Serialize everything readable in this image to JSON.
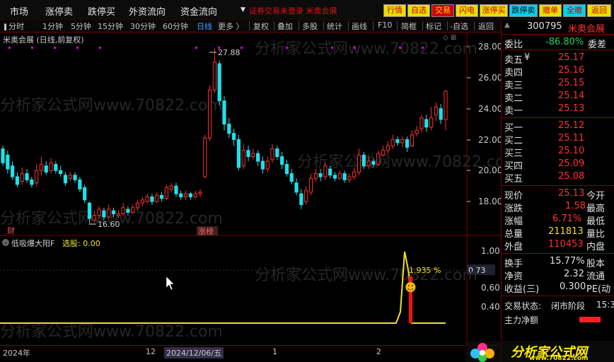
{
  "topbar": {
    "menus": [
      "市场",
      "涨停卖",
      "跌停买",
      "外资流向",
      "资金流向"
    ],
    "alert": "证券交易未登录  米奥会展",
    "buttons": [
      {
        "label": "行情",
        "bg": "#e8e000",
        "fg": "#d00000"
      },
      {
        "label": "自选",
        "bg": "#e8e000",
        "fg": "#d00000"
      },
      {
        "label": "交易",
        "bg": "#d00000",
        "fg": "#e8e000"
      },
      {
        "label": "闪电",
        "bg": "#e8e000",
        "fg": "#d00000"
      },
      {
        "label": "涨停买",
        "bg": "#e8e000",
        "fg": "#d00000"
      },
      {
        "label": "跌停卖",
        "bg": "#00d0f0",
        "fg": "#000000"
      },
      {
        "label": "撤单",
        "bg": "#e8e000",
        "fg": "#d00000"
      },
      {
        "label": "全撤",
        "bg": "#00d0f0",
        "fg": "#d00000"
      },
      {
        "label": "返回",
        "bg": "#e8e000",
        "fg": "#d00000"
      }
    ]
  },
  "toolbar": {
    "periods": [
      "分时",
      "1分钟",
      "5分钟",
      "15分钟",
      "30分钟",
      "60分钟",
      "日线",
      "更多 〉"
    ],
    "active_period": "日线",
    "tools": [
      "复权",
      "叠加",
      "多股",
      "统计",
      "画线",
      "F10",
      "简框",
      "标记",
      "-自选",
      "返回"
    ]
  },
  "chart": {
    "stock_title": "米奥会展 (日线,前复权)",
    "icons": "◇ ⊞",
    "price_axis": [
      "28.00",
      "26.00",
      "24.00",
      "22.00",
      "20.00",
      "18.00"
    ],
    "high_label": "27.88",
    "low_label": "16.60",
    "badge_cai": "财",
    "badge_zhangbang": "涨榜",
    "watermark": "分析家公式网www.70822.com"
  },
  "indicator": {
    "name": "低吸爆大阳F",
    "value": "选股: 0.00",
    "axis": [
      "1.00",
      "0.73",
      "0.60",
      "0.40"
    ],
    "peak_label": "1.935 %",
    "marker": "☻"
  },
  "timeline": {
    "labels": [
      "2024年",
      "12",
      "2024/12/06/五",
      "1",
      "2"
    ]
  },
  "panel": {
    "code": "300795",
    "name": "米奥会展",
    "weibi_label": "委比",
    "weibi_value": "-86.80%",
    "weicha_label": "委差",
    "sells": [
      {
        "label": "卖五",
        "mark": "¥",
        "price": "25.17"
      },
      {
        "label": "卖四",
        "mark": "",
        "price": "25.16"
      },
      {
        "label": "卖三",
        "mark": "",
        "price": "25.15"
      },
      {
        "label": "卖二",
        "mark": "",
        "price": "25.14"
      },
      {
        "label": "卖一",
        "mark": "",
        "price": "25.13"
      }
    ],
    "buys": [
      {
        "label": "买一",
        "price": "25.12"
      },
      {
        "label": "买二",
        "price": "25.11"
      },
      {
        "label": "买三",
        "price": "25.10"
      },
      {
        "label": "买四",
        "price": "25.09"
      },
      {
        "label": "买五",
        "price": "25.08"
      }
    ],
    "stats": [
      {
        "l1": "现价",
        "v1": "25.13",
        "c1": "red",
        "l2": "今开"
      },
      {
        "l1": "涨跌",
        "v1": "1.58",
        "c1": "red",
        "l2": "最高"
      },
      {
        "l1": "涨幅",
        "v1": "6.71%",
        "c1": "red",
        "l2": "最低"
      },
      {
        "l1": "总量",
        "v1": "211813",
        "c1": "yellow",
        "l2": "量比"
      },
      {
        "l1": "外盘",
        "v1": "110453",
        "c1": "red",
        "l2": "内盘"
      },
      {
        "l1": "换手",
        "v1": "15.77%",
        "c1": "white",
        "l2": "股本"
      },
      {
        "l1": "净资",
        "v1": "2.32",
        "c1": "white",
        "l2": "流通"
      },
      {
        "l1": "收益(三)",
        "v1": "0.300",
        "c1": "white",
        "l2": "PE(动"
      }
    ],
    "trade_status_label": "交易状态:",
    "trade_status_value": "闭市阶段",
    "trade_time": "15:3",
    "main_flow_label": "主力净额"
  },
  "logo": {
    "text": "分析家公式网",
    "url": "www.70822.com"
  },
  "colors": {
    "up": "#ff3030",
    "down": "#20e0e8",
    "indicator_line": "#f0e020",
    "magenta_dots": "#e000e0"
  }
}
